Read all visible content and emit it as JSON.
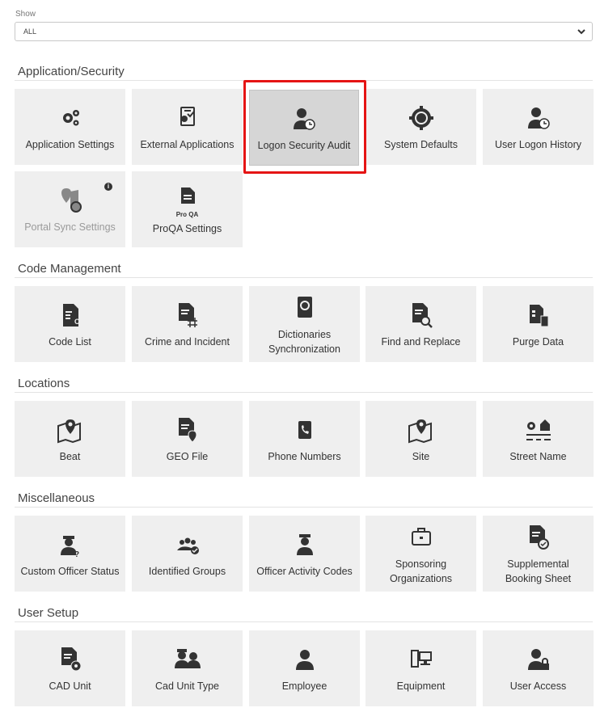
{
  "filter": {
    "label": "Show",
    "value": "ALL"
  },
  "sections": [
    {
      "title": "Application/Security",
      "tiles": [
        {
          "label": "Application Settings",
          "icon": "gears-icon"
        },
        {
          "label": "External Applications",
          "icon": "external-app-icon"
        },
        {
          "label": "Logon Security Audit",
          "icon": "user-clock-icon",
          "selected": true
        },
        {
          "label": "System Defaults",
          "icon": "gear-icon"
        },
        {
          "label": "User Logon History",
          "icon": "user-clock-icon"
        },
        {
          "label": "Portal Sync Settings",
          "icon": "map-sync-icon",
          "disabled": true,
          "info": "i"
        },
        {
          "label": "ProQA Settings",
          "icon": "proqa-doc-icon",
          "iconText": "Pro QA"
        }
      ]
    },
    {
      "title": "Code Management",
      "tiles": [
        {
          "label": "Code List",
          "icon": "code-list-icon"
        },
        {
          "label": "Crime and Incident",
          "icon": "crime-doc-icon"
        },
        {
          "label": "Dictionaries Synchronization",
          "icon": "sync-book-icon"
        },
        {
          "label": "Find and Replace",
          "icon": "doc-search-icon"
        },
        {
          "label": "Purge Data",
          "icon": "purge-icon"
        }
      ]
    },
    {
      "title": "Locations",
      "tiles": [
        {
          "label": "Beat",
          "icon": "map-pin-icon"
        },
        {
          "label": "GEO File",
          "icon": "doc-pin-icon"
        },
        {
          "label": "Phone Numbers",
          "icon": "phone-book-icon"
        },
        {
          "label": "Site",
          "icon": "map-pin-icon"
        },
        {
          "label": "Street Name",
          "icon": "street-icon"
        }
      ]
    },
    {
      "title": "Miscellaneous",
      "tiles": [
        {
          "label": "Custom Officer Status",
          "icon": "officer-question-icon"
        },
        {
          "label": "Identified Groups",
          "icon": "group-check-icon"
        },
        {
          "label": "Officer Activity Codes",
          "icon": "officer-icon"
        },
        {
          "label": "Sponsoring Organizations",
          "icon": "briefcase-icon"
        },
        {
          "label": "Supplemental Booking Sheet",
          "icon": "doc-check-icon"
        }
      ]
    },
    {
      "title": "User Setup",
      "tiles": [
        {
          "label": "CAD Unit",
          "icon": "doc-gear-icon"
        },
        {
          "label": "Cad Unit Type",
          "icon": "officers-icon"
        },
        {
          "label": "Employee",
          "icon": "user-icon"
        },
        {
          "label": "Equipment",
          "icon": "equipment-icon"
        },
        {
          "label": "User Access",
          "icon": "user-lock-icon"
        }
      ]
    }
  ]
}
